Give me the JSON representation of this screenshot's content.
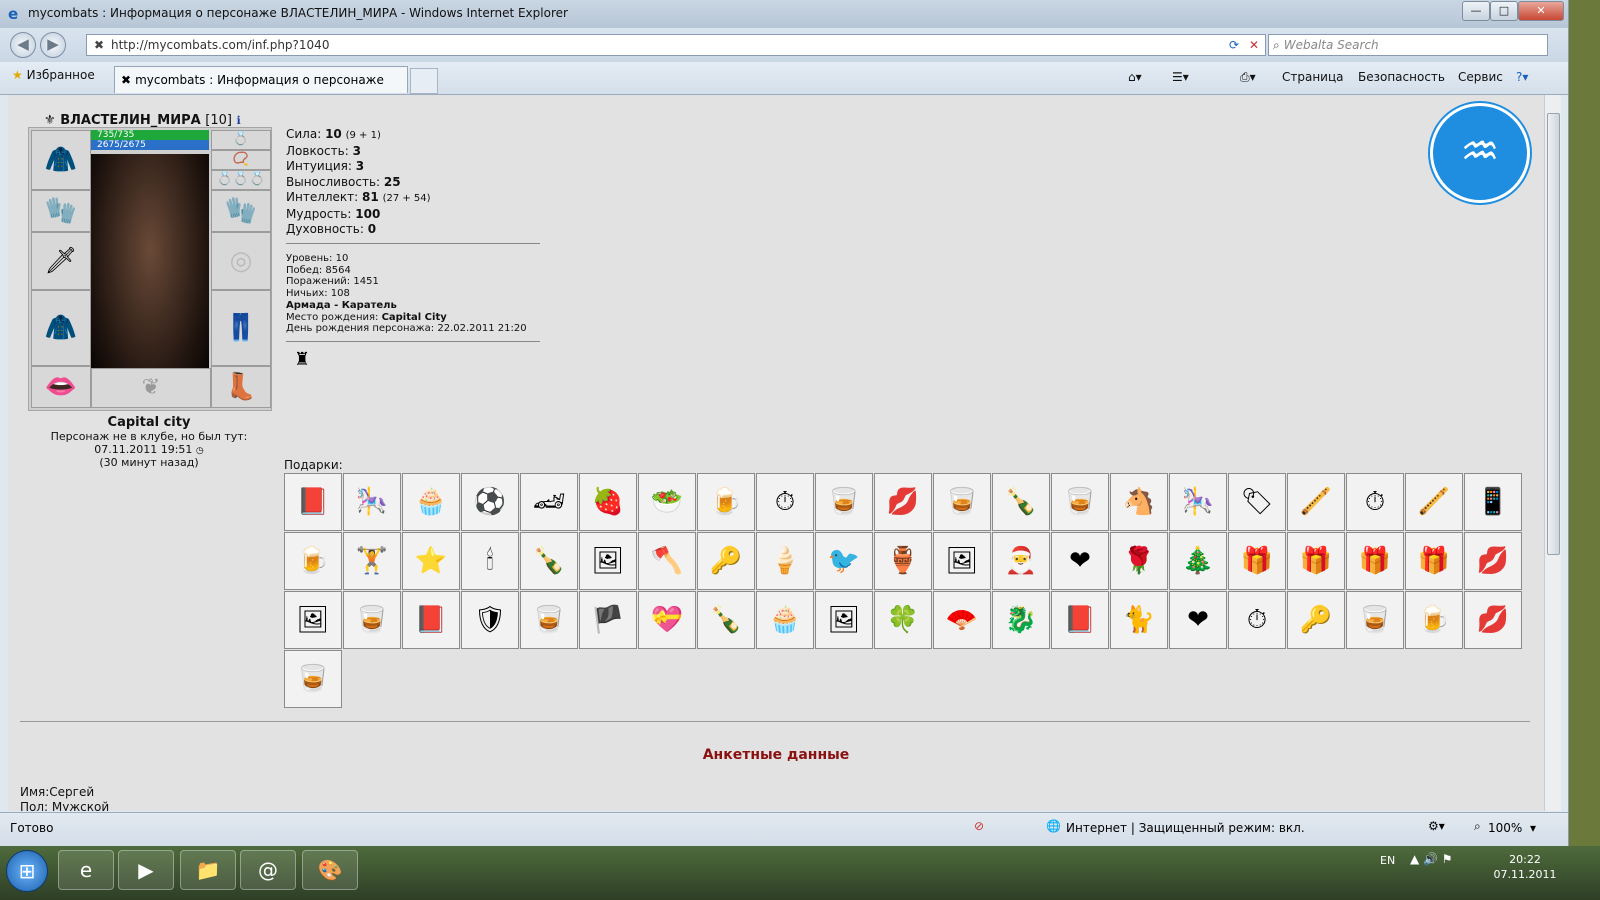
{
  "window": {
    "title": "mycombats : Информация о персонаже ВЛАСТЕЛИН_МИРА - Windows Internet Explorer",
    "controls": [
      "—",
      "□",
      "✕"
    ]
  },
  "address": {
    "url": "http://mycombats.com/inf.php?1040",
    "search_placeholder": "Webalta Search"
  },
  "tabs": {
    "favorites_label": "Избранное",
    "active_tab": "mycombats : Информация о персонаже ВЛАС...",
    "commands": [
      "Страница",
      "Безопасность",
      "Сервис"
    ]
  },
  "character": {
    "name": "ВЛАСТЕЛИН_МИРА",
    "level": "[10]",
    "hp": "735/735",
    "mana": "2675/2675",
    "location": "Capital city",
    "status_line1": "Персонаж не в клубе, но был тут:",
    "status_line2": "07.11.2011 19:51",
    "status_line3": "(30 минут назад)"
  },
  "stats": [
    {
      "label": "Сила:",
      "value": "10",
      "extra": "(9 + 1)"
    },
    {
      "label": "Ловкость:",
      "value": "3",
      "extra": ""
    },
    {
      "label": "Интуиция:",
      "value": "3",
      "extra": ""
    },
    {
      "label": "Выносливость:",
      "value": "25",
      "extra": ""
    },
    {
      "label": "Интеллект:",
      "value": "81",
      "extra": "(27 + 54)"
    },
    {
      "label": "Мудрость:",
      "value": "100",
      "extra": ""
    },
    {
      "label": "Духовность:",
      "value": "0",
      "extra": ""
    }
  ],
  "info": {
    "level": "Уровень: 10",
    "wins": "Побед: 8564",
    "losses": "Поражений: 1451",
    "draws": "Ничьих: 108",
    "clan": "Армада - Каратель",
    "birthplace_label": "Место рождения:",
    "birthplace": "Capital City",
    "birthday": "День рождения персонажа: 22.02.2011 21:20"
  },
  "gifts": {
    "label": "Подарки:",
    "items": [
      "📕",
      "🎠",
      "🧁",
      "⚽",
      "🏎",
      "🍓",
      "🥗",
      "🍺",
      "⏱",
      "🥃",
      "💋",
      "🥃",
      "🍾",
      "🥃",
      "🐴",
      "🎠",
      "🏷",
      "🪈",
      "⏱",
      "🪈",
      "📱",
      "🍺",
      "🏋",
      "⭐",
      "🕯",
      "🍾",
      "🖼",
      "🪓",
      "🔑",
      "🍦",
      "🐦",
      "🏺",
      "🖼",
      "🎅",
      "❤",
      "🌹",
      "🎄",
      "🎁",
      "🎁",
      "🎁",
      "🎁",
      "💋",
      "🖼",
      "🥃",
      "📕",
      "🛡",
      "🥃",
      "🏴",
      "💝",
      "🍾",
      "🧁",
      "🖼",
      "🍀",
      "🪭",
      "🐉",
      "📕",
      "🐈",
      "❤",
      "⏱",
      "🔑",
      "🥃",
      "🍺",
      "💋",
      "🥃"
    ]
  },
  "profile": {
    "heading": "Анкетные данные",
    "name": "Имя:Сергей",
    "gender": "Пол: Мужской"
  },
  "status": {
    "text": "Готово",
    "zone": "Интернет | Защищенный режим: вкл.",
    "zoom": "100%"
  },
  "taskbar": {
    "lang": "EN",
    "time": "20:22",
    "date": "07.11.2011"
  }
}
